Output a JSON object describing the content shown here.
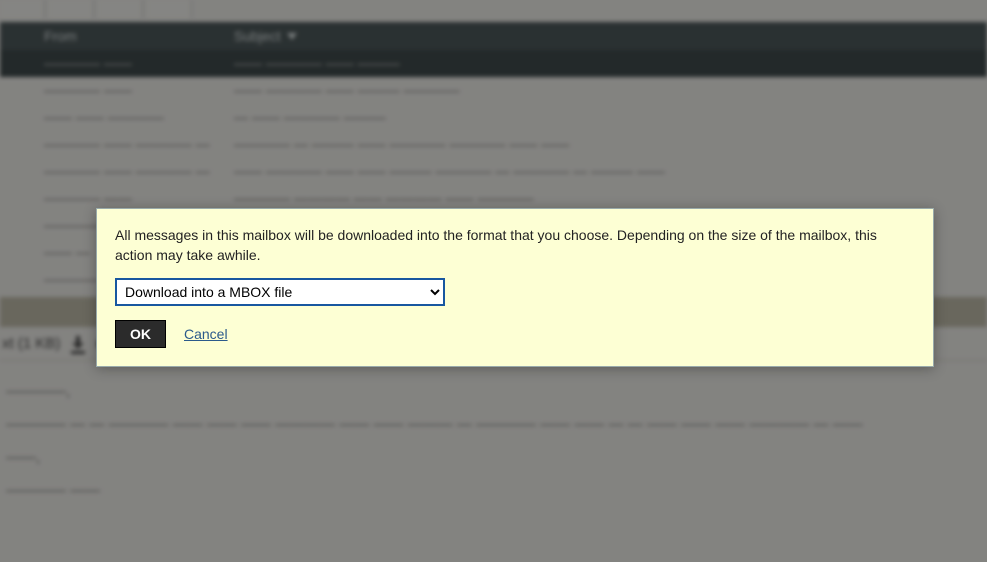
{
  "toolbar": {
    "items": [
      "",
      "",
      "",
      ""
    ]
  },
  "columns": {
    "from": "From",
    "subject": "Subject"
  },
  "messages": [
    {
      "from": "———— ——",
      "subject": "——  ————  ——  ———",
      "selected": true
    },
    {
      "from": "———— ——",
      "subject": "——  ————  ——  ———  ————"
    },
    {
      "from": "——  ——  ————",
      "subject": "—  ——  ————  ———"
    },
    {
      "from": "————  ——  ————  —",
      "subject": "————  —  ———  ——  ————  ————  ——  ——"
    },
    {
      "from": "————  ——  ————  —",
      "subject": "——  ————  ——  ——  ———  ————  —  ————  —  ———  ——"
    },
    {
      "from": "————  ——",
      "subject": "————  ————  ——  ————  ——  ————"
    },
    {
      "from": "————  —",
      "subject": ""
    },
    {
      "from": "——  —",
      "subject": ""
    },
    {
      "from": "————",
      "subject": ""
    }
  ],
  "attachment": {
    "label": "xt (1 KB)"
  },
  "body_lines": [
    "————,",
    "————  —  —  ————  ——  ——  ——  ————  ——  ——  ———  —  ————  ——  ——  —  —  ——  ——  ——  ————  —  ——",
    "——,",
    "————  ——"
  ],
  "dialog": {
    "message": "All messages in this mailbox will be downloaded into the format that you choose. Depending on the size of the mailbox, this action may take awhile.",
    "format_selected": "Download into a MBOX file",
    "ok": "OK",
    "cancel": "Cancel"
  }
}
